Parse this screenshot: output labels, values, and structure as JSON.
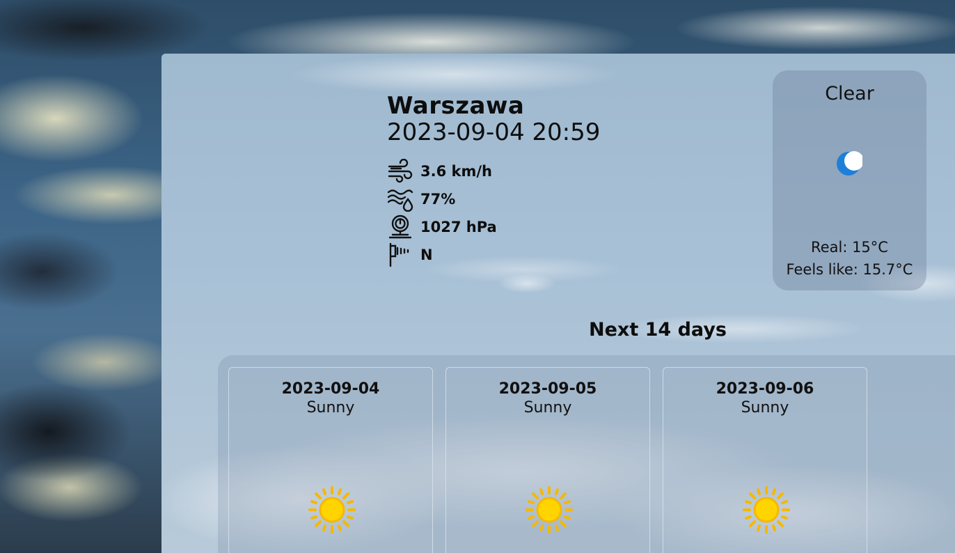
{
  "current": {
    "city": "Warszawa",
    "datetime": "2023-09-04 20:59",
    "stats": [
      {
        "icon": "wind-icon",
        "value": "3.6 km/h"
      },
      {
        "icon": "humidity-icon",
        "value": "77%"
      },
      {
        "icon": "pressure-gauge-icon",
        "value": "1027 hPa"
      },
      {
        "icon": "windsock-direction-icon",
        "value": "N"
      }
    ]
  },
  "summary": {
    "condition": "Clear",
    "icon": "moon-icon",
    "real": "Real: 15°C",
    "feels_like": "Feels like: 15.7°C"
  },
  "forecast": {
    "title": "Next 14 days",
    "days": [
      {
        "date": "2023-09-04",
        "description": "Sunny",
        "icon": "sun-icon"
      },
      {
        "date": "2023-09-05",
        "description": "Sunny",
        "icon": "sun-icon"
      },
      {
        "date": "2023-09-06",
        "description": "Sunny",
        "icon": "sun-icon"
      }
    ]
  },
  "colors": {
    "text": "#0d0d0d",
    "moon": "#1e7fd8",
    "sun_core": "#ffd400",
    "sun_ray": "#f5b800"
  }
}
